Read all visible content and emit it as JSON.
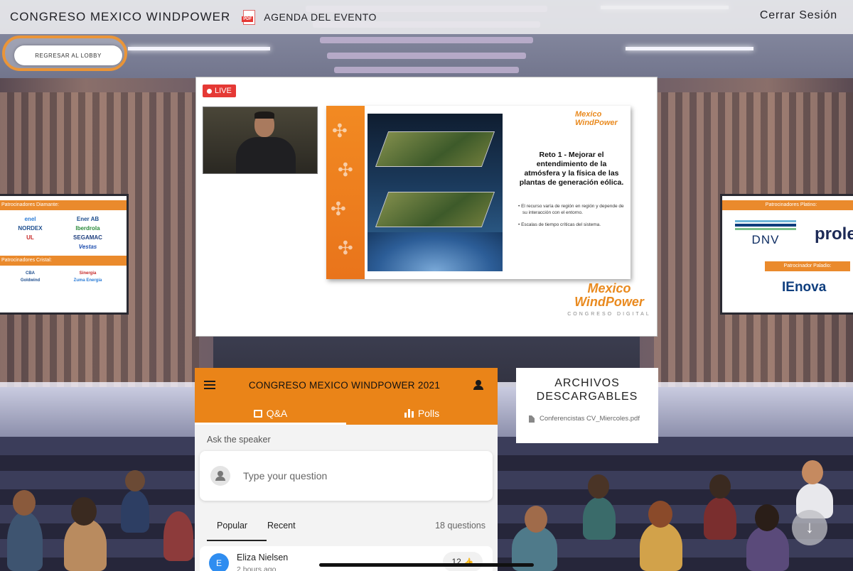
{
  "topbar": {
    "brand": "CONGRESO MEXICO WINDPOWER",
    "pdf_badge": "PDF",
    "agenda_link": "AGENDA DEL EVENTO",
    "logout": "Cerrar Sesión"
  },
  "lobby_button": "REGRESAR AL LOBBY",
  "stream": {
    "live_badge": "LIVE",
    "slide": {
      "logo": "Mexico\nWindPower",
      "title": "Reto 1 - Mejorar el entendimiento de la atmósfera y la física de las plantas de generación eólica.",
      "bullets": [
        "• El recurso varía de región en región y depende de su interacción con el entorno.",
        "• Escalas de tiempo críticas del sistema."
      ]
    },
    "event_logo": {
      "name": "Mexico WindPower",
      "tagline": "CONGRESO DIGITAL"
    }
  },
  "sponsors_left": {
    "diamond_label": "Patrocinadores Diamante:",
    "diamond": [
      "enel",
      "Ener AB",
      "NORDEX",
      "Iberdrola",
      "UL",
      "SEGAMAC",
      "",
      "Vestas"
    ],
    "crystal_label": "Patrocinadores Cristal:",
    "crystal": [
      "CBA",
      "Sinergia",
      "Goldwind",
      "Zuma Energía"
    ]
  },
  "sponsors_right": {
    "platinum_label": "Patrocinadores Platino:",
    "platinum": [
      "DNV",
      "prolec"
    ],
    "palladium_label": "Patrocinador Paladio:",
    "palladium": [
      "IEnova"
    ]
  },
  "qa": {
    "header_title": "CONGRESO MEXICO WINDPOWER 2021",
    "tabs": [
      {
        "label": "Q&A",
        "active": true
      },
      {
        "label": "Polls",
        "active": false
      }
    ],
    "ask_label": "Ask the speaker",
    "input_placeholder": "Type your question",
    "sort_tabs": [
      "Popular",
      "Recent"
    ],
    "question_count": "18 questions",
    "questions": [
      {
        "avatar_letter": "E",
        "author": "Eliza Nielsen",
        "time": "2 hours ago",
        "likes": "12"
      }
    ],
    "accent_color": "#ea8418",
    "avatar_color": "#2f8df0"
  },
  "downloads": {
    "title": "ARCHIVOS DESCARGABLES",
    "files": [
      "Conferencistas CV_Miercoles.pdf"
    ]
  },
  "fab_icon": "arrow-down-icon"
}
